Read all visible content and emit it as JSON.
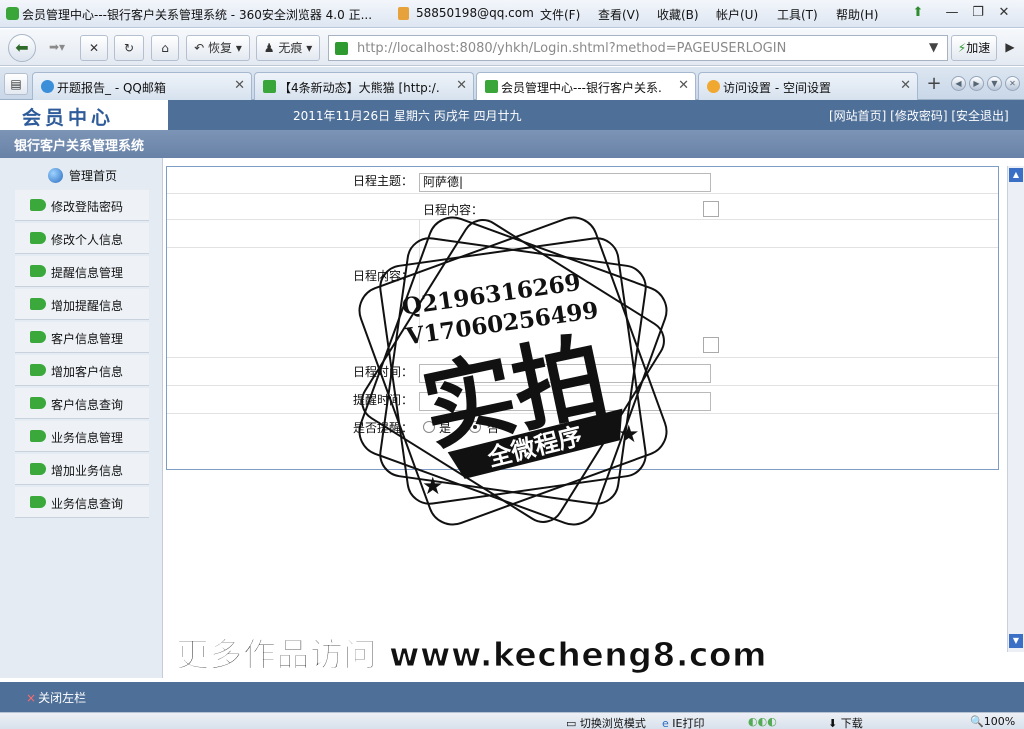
{
  "browser": {
    "window_title": "会员管理中心---银行客户关系管理系统 - 360安全浏览器 4.0 正...",
    "account": "58850198@qq.com",
    "menu": [
      "文件(F)",
      "查看(V)",
      "收藏(B)",
      "帐户(U)",
      "工具(T)",
      "帮助(H)"
    ],
    "toolbar": {
      "restore_label": "恢复",
      "incognito_label": "无痕",
      "speed_label": "加速"
    },
    "url": "http://localhost:8080/yhkh/Login.shtml?method=PAGEUSERLOGIN",
    "tabs": [
      {
        "label": "开题报告_ - QQ邮箱",
        "active": false
      },
      {
        "label": "【4条新动态】大熊猫 [http:/...",
        "active": false
      },
      {
        "label": "会员管理中心---银行客户关系...",
        "active": true
      },
      {
        "label": "访问设置 - 空间设置",
        "active": false
      }
    ]
  },
  "page": {
    "logo_text": "会员中心",
    "date_text": "2011年11月26日 星期六 丙戌年 四月廿九",
    "header_links": "[网站首页] [修改密码] [安全退出]",
    "system_title": "银行客户关系管理系统",
    "sidebar": {
      "home_label": "管理首页",
      "items": [
        "修改登陆密码",
        "修改个人信息",
        "提醒信息管理",
        "增加提醒信息",
        "客户信息管理",
        "增加客户信息",
        "客户信息查询",
        "业务信息管理",
        "增加业务信息",
        "业务信息查询"
      ]
    },
    "form": {
      "subject_label": "日程主题：",
      "subject_value": "阿萨德|",
      "content_label": "日程内容：",
      "content_inner_label": "日程内容：",
      "time_label": "日程时间：",
      "remind_time_label": "提醒时间：",
      "remind_label": "是否提醒：",
      "remind_options": [
        "是",
        "否"
      ]
    },
    "footer_label": "关闭左栏"
  },
  "statusbar": {
    "mode_label": "切换浏览模式",
    "ie_label": "IE打印",
    "download_label": "下载",
    "zoom_label": "100%"
  },
  "watermark": {
    "stamp_line1": "Q2196316269",
    "stamp_line2": "V17060256499",
    "stamp_main": "实拍",
    "stamp_banner": "全微程序",
    "bottom_text": "更多作品访问 www.kecheng8.com"
  }
}
